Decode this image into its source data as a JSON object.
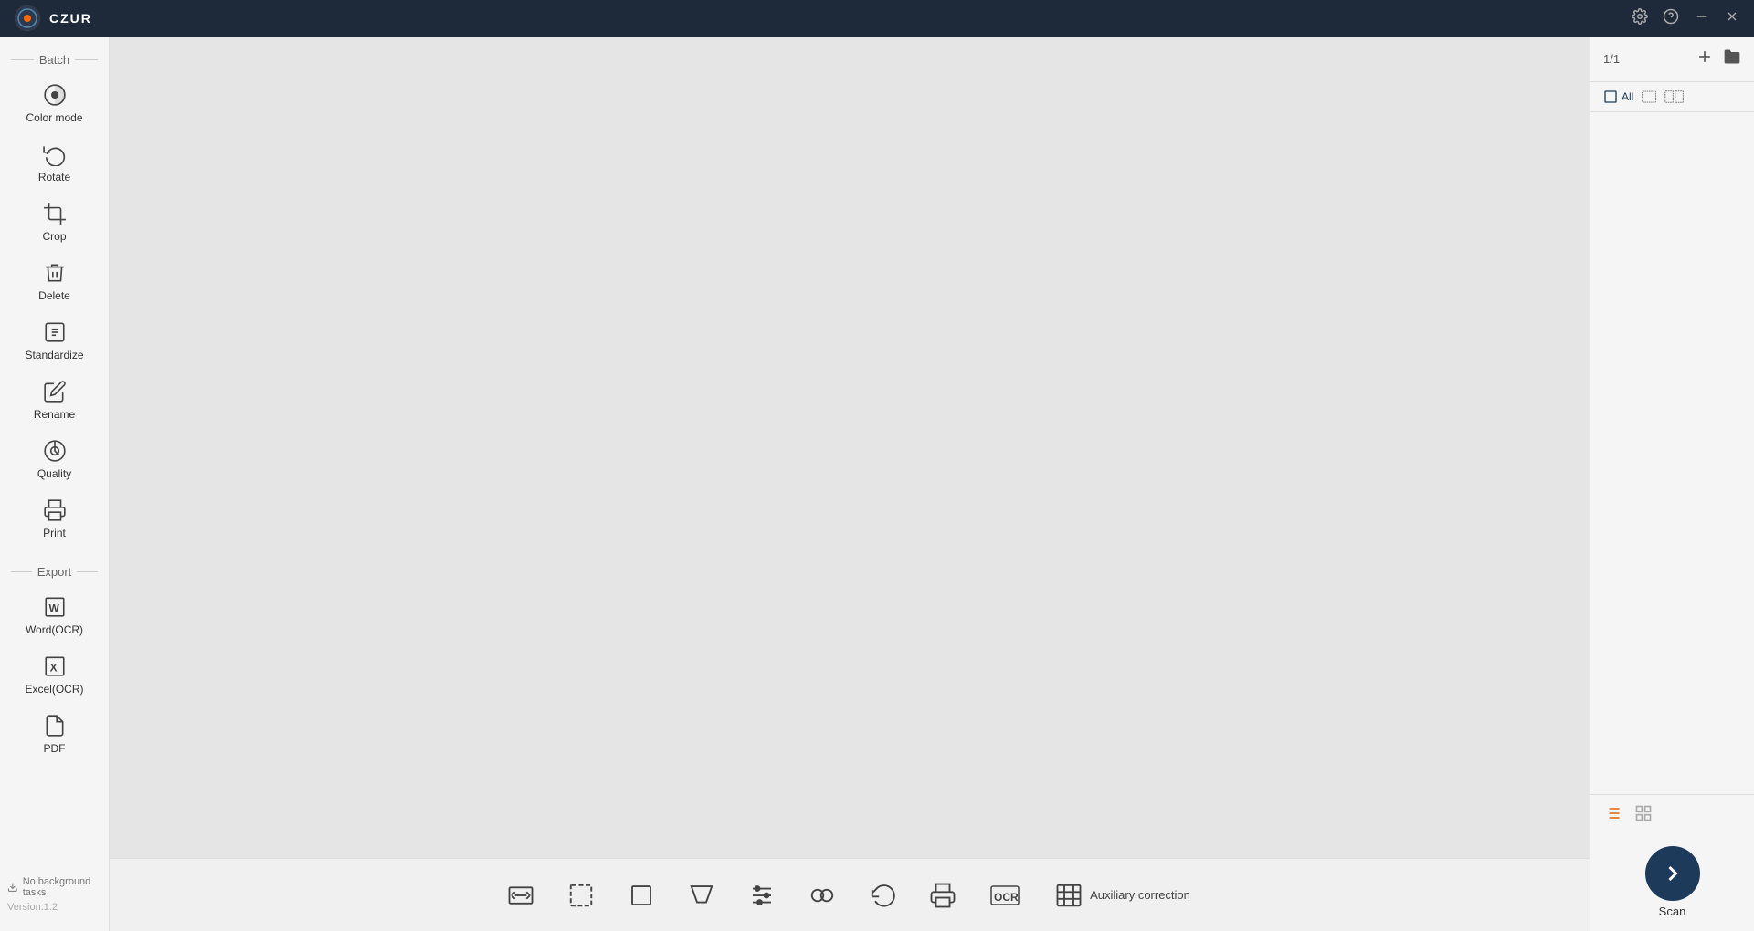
{
  "app": {
    "logo_text": "C",
    "title": "CZUR"
  },
  "titlebar": {
    "controls": {
      "settings_label": "settings-icon",
      "help_label": "help-icon",
      "minimize_label": "minimize-icon",
      "close_label": "close-icon"
    }
  },
  "sidebar": {
    "batch_label": "Batch",
    "export_label": "Export",
    "items": [
      {
        "id": "color-mode",
        "label": "Color mode",
        "icon": "🎨"
      },
      {
        "id": "rotate",
        "label": "Rotate",
        "icon": "🔄"
      },
      {
        "id": "crop",
        "label": "Crop",
        "icon": "✂️"
      },
      {
        "id": "delete",
        "label": "Delete",
        "icon": "🗑️"
      },
      {
        "id": "standardize",
        "label": "Standardize",
        "icon": "📋"
      },
      {
        "id": "rename",
        "label": "Rename",
        "icon": "✏️"
      },
      {
        "id": "quality",
        "label": "Quality",
        "icon": "⚙️"
      },
      {
        "id": "print",
        "label": "Print",
        "icon": "🖨️"
      },
      {
        "id": "word-ocr",
        "label": "Word(OCR)",
        "icon": "W"
      },
      {
        "id": "excel-ocr",
        "label": "Excel(OCR)",
        "icon": "X"
      },
      {
        "id": "pdf",
        "label": "PDF",
        "icon": "📄"
      }
    ]
  },
  "bottom_toolbar": {
    "items": [
      {
        "id": "fit-width",
        "label": ""
      },
      {
        "id": "selection",
        "label": ""
      },
      {
        "id": "crop-tool",
        "label": ""
      },
      {
        "id": "perspective",
        "label": ""
      },
      {
        "id": "adjust",
        "label": ""
      },
      {
        "id": "combine",
        "label": ""
      },
      {
        "id": "undo",
        "label": ""
      },
      {
        "id": "print-tool",
        "label": ""
      },
      {
        "id": "ocr",
        "label": ""
      }
    ],
    "auxiliary_correction": "Auxiliary correction"
  },
  "right_panel": {
    "page_counter": "1/1",
    "view_all_label": "All",
    "scan_label": "Scan"
  },
  "statusbar": {
    "no_background_tasks": "No background tasks",
    "version": "Version:1.2"
  }
}
